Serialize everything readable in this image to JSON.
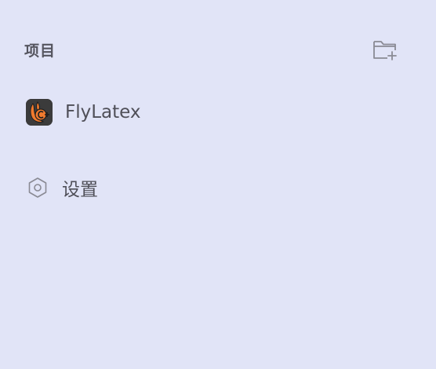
{
  "sidebar": {
    "section_title": "项目",
    "new_folder_icon": "folder-plus-icon",
    "projects": [
      {
        "label": "FlyLatex",
        "icon": "flylatex-app-icon"
      }
    ],
    "settings": {
      "label": "设置",
      "icon": "hexagon-gear-icon"
    }
  },
  "colors": {
    "background": "#e1e4f7",
    "text": "#4f4f58",
    "icon_stroke": "#8a8a94",
    "app_icon_bg": "#3b3b3b",
    "app_icon_accent": "#f07a2e"
  }
}
